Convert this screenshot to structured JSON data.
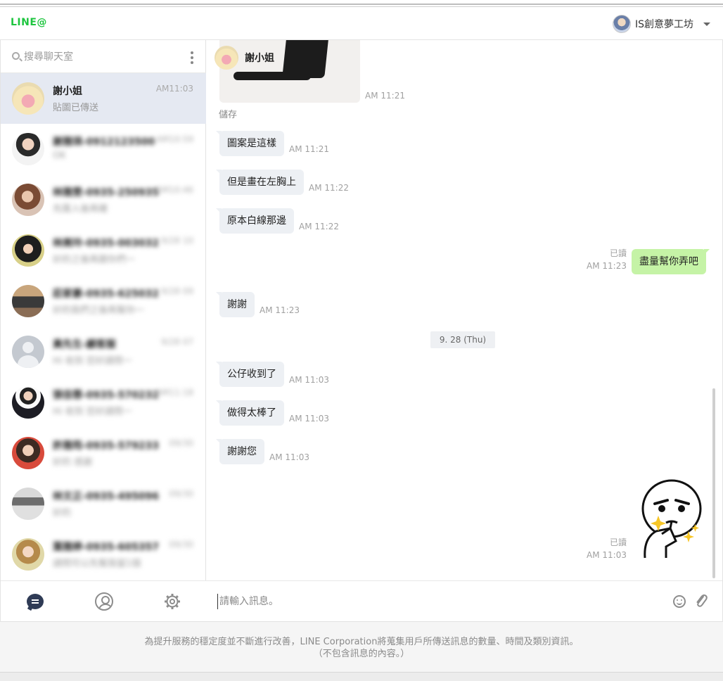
{
  "app": {
    "logo": "LINE@",
    "account_name": "IS創意夢工坊"
  },
  "sidebar": {
    "search_placeholder": "搜尋聊天室",
    "chats": [
      {
        "name": "謝小姐",
        "preview": "貼圖已傳送",
        "time": "AM11:03",
        "avatar": "pig"
      },
      {
        "name": "謝雅琪-0912123500",
        "preview": "OK",
        "time": "AM10:59",
        "avatar": "1"
      },
      {
        "name": "林雅雯-0935-250935",
        "preview": "先匯入後再確",
        "time": "AM10:46",
        "avatar": "2"
      },
      {
        "name": "林美玲-0935-003032",
        "preview": "好的之後再跟你們一",
        "time": "9/28 10",
        "avatar": "3"
      },
      {
        "name": "莊家豪-0935-625032",
        "preview": "好的我們之後再幫你一",
        "time": "9/28 09",
        "avatar": "4"
      },
      {
        "name": "黃先生-顧客服",
        "preview": "Hi 收到 您好請問一",
        "time": "9/28 07",
        "avatar": "5"
      },
      {
        "name": "張佳蓉-0935-570232",
        "preview": "Hi 收到 您好請問一",
        "time": "AM11:18",
        "avatar": "6"
      },
      {
        "name": "許雅筠-0935-579233",
        "preview": "好的 感謝",
        "time": "09/30",
        "avatar": "7"
      },
      {
        "name": "林文正-0935-495096",
        "preview": "好的",
        "time": "09/30",
        "avatar": "8"
      },
      {
        "name": "葉雅婷-0935-605357",
        "preview": "請問可以先幫我留1個",
        "time": "09/30",
        "avatar": "9"
      }
    ]
  },
  "conversation": {
    "title": "謝小姐",
    "image_time": "AM 11:21",
    "save_label": "儲存",
    "messages": [
      {
        "text": "圖案是這樣",
        "time": "AM 11:21"
      },
      {
        "text": "但是畫在左胸上",
        "time": "AM 11:22"
      },
      {
        "text": "原本白線那邊",
        "time": "AM 11:22"
      },
      {
        "text": "盡量幫你弄吧",
        "time": "AM 11:23",
        "read": "已讀"
      },
      {
        "text": "謝謝",
        "time": "AM 11:23"
      },
      {
        "text": "公仔收到了",
        "time": "AM 11:03"
      },
      {
        "text": "做得太棒了",
        "time": "AM 11:03"
      },
      {
        "text": "謝謝您",
        "time": "AM 11:03"
      }
    ],
    "date_divider": "9. 28 (Thu)",
    "sticker_read": "已讀",
    "sticker_time": "AM 11:03",
    "input_placeholder": "請輸入訊息。"
  },
  "footer": {
    "line1": "為提升服務的穩定度並不斷進行改善，LINE Corporation將蒐集用戶所傳送訊息的數量、時間及類別資訊。",
    "line2": "（不包含訊息的內容。）"
  },
  "colors": {
    "brand": "#1ec53f",
    "my_bubble": "#c5f3a6",
    "their_bubble": "#edf0f4",
    "active_row": "#e5e9f2"
  }
}
